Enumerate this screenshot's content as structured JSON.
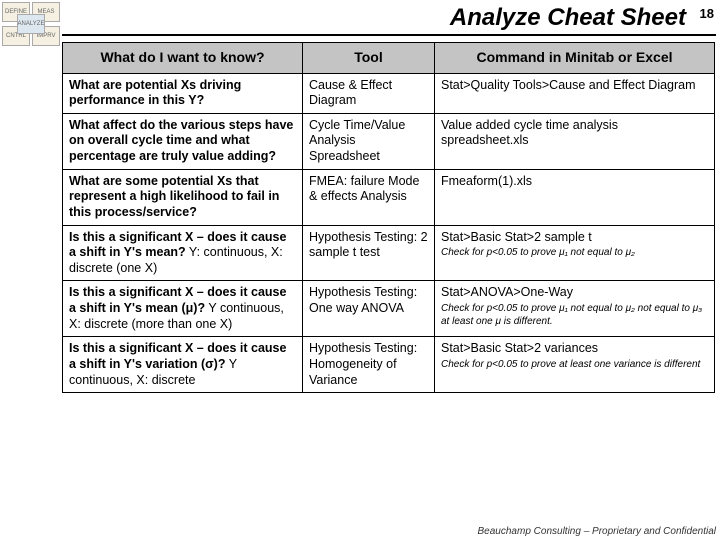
{
  "title": "Analyze Cheat Sheet",
  "page_number": "18",
  "badge": {
    "define": "DEFINE",
    "measure": "MEAS",
    "analyze": "ANALYZE",
    "control": "CNTRL",
    "improve": "IMPRV"
  },
  "headers": {
    "question": "What do I want to know?",
    "tool": "Tool",
    "command": "Command in Minitab or Excel"
  },
  "rows": [
    {
      "q_bold": "What are potential Xs driving performance in this Y?",
      "q_rest": "",
      "tool": "Cause & Effect Diagram",
      "cmd": "Stat>Quality Tools>Cause and Effect Diagram",
      "cmd_sub": ""
    },
    {
      "q_bold": "What affect do the various steps have on overall cycle time and what percentage are truly value adding?",
      "q_rest": "",
      "tool": "Cycle Time/Value Analysis Spreadsheet",
      "cmd": "Value added cycle time analysis spreadsheet.xls",
      "cmd_sub": ""
    },
    {
      "q_bold": "What are some potential Xs that represent a high likelihood to fail in this process/service?",
      "q_rest": "",
      "tool": "FMEA: failure Mode & effects Analysis",
      "cmd": "Fmeaform(1).xls",
      "cmd_sub": ""
    },
    {
      "q_bold": "Is this a significant X – does it cause a shift in Y's mean?",
      "q_rest": "  Y: continuous, X: discrete (one X)",
      "tool": "Hypothesis Testing: 2 sample t test",
      "cmd": "Stat>Basic Stat>2 sample t",
      "cmd_sub": "Check for p<0.05 to prove μ₁ not equal to μ₂"
    },
    {
      "q_bold": "Is this a significant X – does it cause a shift in Y's mean (μ)?",
      "q_rest": " Y continuous, X: discrete (more than one X)",
      "tool": "Hypothesis Testing: One way ANOVA",
      "cmd": "Stat>ANOVA>One-Way",
      "cmd_sub": "Check for p<0.05 to prove μ₁ not equal to μ₂ not equal to μ₃    at least one μ is different."
    },
    {
      "q_bold": "Is this a significant X – does it cause a shift in Y's variation (σ)?",
      "q_rest": " Y continuous, X: discrete",
      "tool": "Hypothesis Testing: Homogeneity of Variance",
      "cmd": "Stat>Basic Stat>2 variances",
      "cmd_sub": "Check for p<0.05 to prove at least one variance is different"
    }
  ],
  "footer": "Beauchamp Consulting – Proprietary and Confidential"
}
